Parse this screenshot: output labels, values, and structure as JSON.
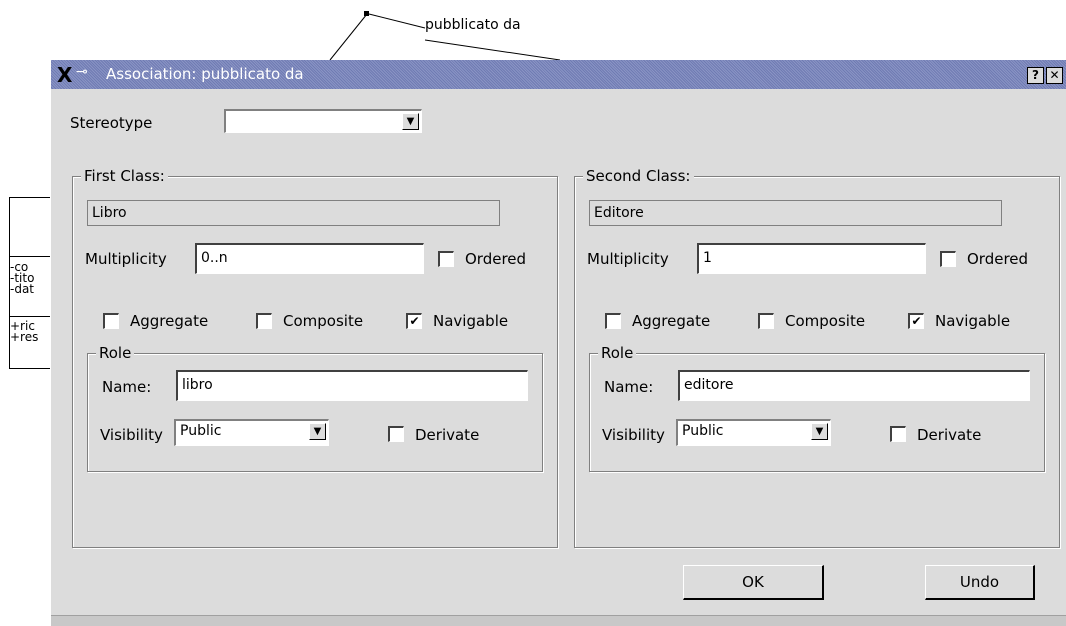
{
  "background": {
    "association_label": "pubblicato da",
    "class_attributes": [
      "-co",
      "-tito",
      "-dat"
    ],
    "class_operations": [
      "+ric",
      "+res"
    ]
  },
  "dialog": {
    "title": "Association: pubblicato da",
    "help_label": "?",
    "close_label": "✕",
    "stereotype_label": "Stereotype",
    "stereotype_value": "",
    "first": {
      "group_title": "First Class:",
      "class_name": "Libro",
      "multiplicity_label": "Multiplicity",
      "multiplicity_value": "0..n",
      "ordered_label": "Ordered",
      "aggregate_label": "Aggregate",
      "composite_label": "Composite",
      "navigable_label": "Navigable",
      "role_title": "Role",
      "name_label": "Name:",
      "name_value": "libro",
      "visibility_label": "Visibility",
      "visibility_value": "Public",
      "derivate_label": "Derivate"
    },
    "second": {
      "group_title": "Second Class:",
      "class_name": "Editore",
      "multiplicity_label": "Multiplicity",
      "multiplicity_value": "1",
      "ordered_label": "Ordered",
      "aggregate_label": "Aggregate",
      "composite_label": "Composite",
      "navigable_label": "Navigable",
      "role_title": "Role",
      "name_label": "Name:",
      "name_value": "editore",
      "visibility_label": "Visibility",
      "visibility_value": "Public",
      "derivate_label": "Derivate"
    },
    "ok_label": "OK",
    "undo_label": "Undo",
    "checked_mark": "✔"
  }
}
